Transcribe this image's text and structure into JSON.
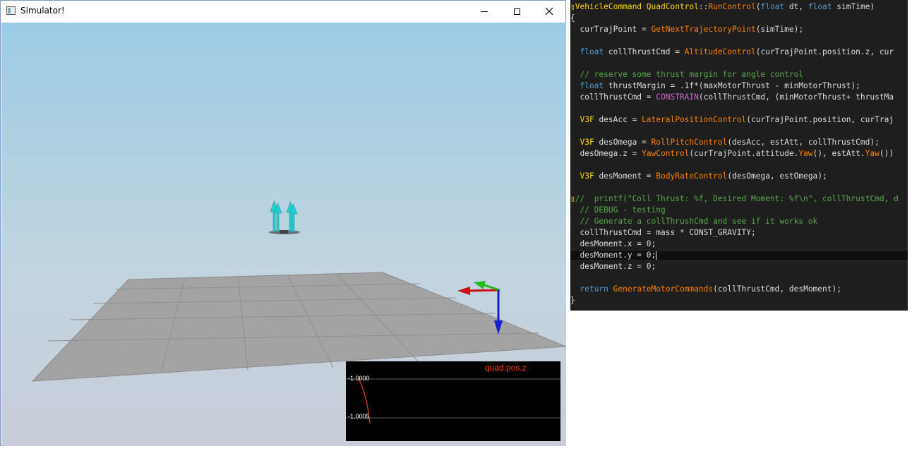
{
  "window": {
    "title": "Simulator!",
    "buttons": {
      "minimize": "minimize-icon",
      "maximize": "maximize-icon",
      "close": "close-icon"
    }
  },
  "viewport": {
    "colors": {
      "sky_top": "#9ccbe5",
      "sky_bottom": "#c8cdd9",
      "ground": "#a3a3a3",
      "grid": "#8f8f8f"
    },
    "axes_gizmo": {
      "x_color": "#cc1111",
      "y_color": "#22bb22",
      "z_color": "#1122cc"
    },
    "plot": {
      "title": "quad.pos.z",
      "ticks": [
        "-1.0000",
        "-1.0005"
      ],
      "title_color": "#ff3b1e",
      "line_color": "#ff3b1e"
    }
  },
  "editor": {
    "lines": [
      [
        {
          "c": "brace-mark",
          "t": "▯"
        },
        {
          "c": "t-vcm",
          "t": "VehicleCommand"
        },
        {
          "c": "",
          "t": " "
        },
        {
          "c": "t-cls",
          "t": "QuadControl"
        },
        {
          "c": "",
          "t": "::"
        },
        {
          "c": "t-fn",
          "t": "RunControl"
        },
        {
          "c": "",
          "t": "("
        },
        {
          "c": "t-kw",
          "t": "float"
        },
        {
          "c": "",
          "t": " dt, "
        },
        {
          "c": "t-kw",
          "t": "float"
        },
        {
          "c": "",
          "t": " simTime)"
        }
      ],
      [
        {
          "c": "",
          "t": "{"
        }
      ],
      [
        {
          "c": "",
          "t": "  curTrajPoint = "
        },
        {
          "c": "t-fn",
          "t": "GetNextTrajectoryPoint"
        },
        {
          "c": "",
          "t": "(simTime);"
        }
      ],
      [
        {
          "c": "",
          "t": ""
        }
      ],
      [
        {
          "c": "",
          "t": "  "
        },
        {
          "c": "t-kw",
          "t": "float"
        },
        {
          "c": "",
          "t": " collThrustCmd = "
        },
        {
          "c": "t-fn",
          "t": "AltitudeControl"
        },
        {
          "c": "",
          "t": "(curTrajPoint.position.z, cur"
        }
      ],
      [
        {
          "c": "",
          "t": ""
        }
      ],
      [
        {
          "c": "t-cm",
          "t": "  // reserve some thrust margin for angle control"
        }
      ],
      [
        {
          "c": "",
          "t": "  "
        },
        {
          "c": "t-kw",
          "t": "float"
        },
        {
          "c": "",
          "t": " thrustMargin = .1f*(maxMotorThrust - minMotorThrust);"
        }
      ],
      [
        {
          "c": "",
          "t": "  collThrustCmd = "
        },
        {
          "c": "t-macro",
          "t": "CONSTRAIN"
        },
        {
          "c": "",
          "t": "(collThrustCmd, (minMotorThrust+ thrustMa"
        }
      ],
      [
        {
          "c": "",
          "t": ""
        }
      ],
      [
        {
          "c": "",
          "t": "  "
        },
        {
          "c": "t-cls",
          "t": "V3F"
        },
        {
          "c": "",
          "t": " desAcc = "
        },
        {
          "c": "t-fn",
          "t": "LateralPositionControl"
        },
        {
          "c": "",
          "t": "(curTrajPoint.position, curTraj"
        }
      ],
      [
        {
          "c": "",
          "t": ""
        }
      ],
      [
        {
          "c": "",
          "t": "  "
        },
        {
          "c": "t-cls",
          "t": "V3F"
        },
        {
          "c": "",
          "t": " desOmega = "
        },
        {
          "c": "t-fn",
          "t": "RollPitchControl"
        },
        {
          "c": "",
          "t": "(desAcc, estAtt, collThrustCmd);"
        }
      ],
      [
        {
          "c": "",
          "t": "  desOmega.z = "
        },
        {
          "c": "t-fn",
          "t": "YawControl"
        },
        {
          "c": "",
          "t": "(curTrajPoint.attitude."
        },
        {
          "c": "t-fn",
          "t": "Yaw"
        },
        {
          "c": "",
          "t": "(), estAtt."
        },
        {
          "c": "t-fn",
          "t": "Yaw"
        },
        {
          "c": "",
          "t": "())"
        }
      ],
      [
        {
          "c": "",
          "t": ""
        }
      ],
      [
        {
          "c": "",
          "t": "  "
        },
        {
          "c": "t-cls",
          "t": "V3F"
        },
        {
          "c": "",
          "t": " desMoment = "
        },
        {
          "c": "t-fn",
          "t": "BodyRateControl"
        },
        {
          "c": "",
          "t": "(desOmega, estOmega);"
        }
      ],
      [
        {
          "c": "",
          "t": ""
        }
      ],
      [
        {
          "c": "brace-mark",
          "t": "▯"
        },
        {
          "c": "t-cm",
          "t": "//  printf(\"Coll Thrust: %f, Desired Moment: %f\\n\", collThrustCmd, d"
        }
      ],
      [
        {
          "c": "t-cm",
          "t": "  // DEBUG - testing"
        }
      ],
      [
        {
          "c": "t-cm",
          "t": "  // Generate a collThrushCmd and see if it works ok"
        }
      ],
      [
        {
          "c": "",
          "t": "  collThrustCmd = mass * CONST_GRAVITY;"
        }
      ],
      [
        {
          "c": "",
          "t": "  desMoment.x = 0;"
        }
      ],
      [
        {
          "c": "",
          "t": "  desMoment.y = 0;"
        },
        {
          "c": "caret",
          "t": ""
        }
      ],
      [
        {
          "c": "",
          "t": "  desMoment.z = 0;"
        }
      ],
      [
        {
          "c": "",
          "t": ""
        }
      ],
      [
        {
          "c": "",
          "t": "  "
        },
        {
          "c": "t-kw",
          "t": "return"
        },
        {
          "c": "",
          "t": " "
        },
        {
          "c": "t-fn",
          "t": "GenerateMotorCommands"
        },
        {
          "c": "",
          "t": "(collThrustCmd, desMoment);"
        }
      ],
      [
        {
          "c": "",
          "t": "}"
        }
      ]
    ],
    "current_line": 22
  }
}
